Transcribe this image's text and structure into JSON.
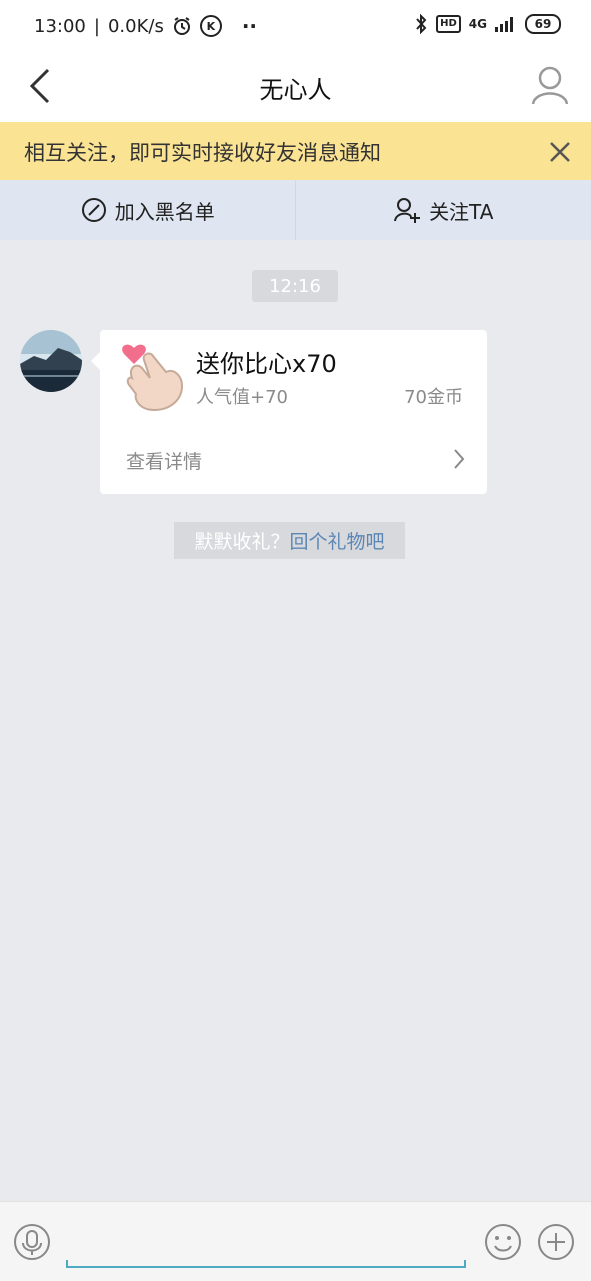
{
  "status_bar": {
    "time": "13:00",
    "speed": "0.0K/s",
    "network": "4G",
    "hd": "HD",
    "battery": "69",
    "dots": "··",
    "k_badge": "K"
  },
  "header": {
    "title": "无心人",
    "icons": {
      "back": "chevron-left-icon",
      "profile": "user-icon"
    }
  },
  "notice": {
    "text": "相互关注，即可实时接收好友消息通知"
  },
  "actions": {
    "blacklist": "加入黑名单",
    "follow": "关注TA"
  },
  "chat": {
    "timestamp": "12:16",
    "gift": {
      "title": "送你比心x70",
      "popularity": "人气值+70",
      "coins": "70金币",
      "detail": "查看详情"
    },
    "reply_prompt": {
      "muted": "默默收礼？",
      "link": "回个礼物吧"
    }
  },
  "colors": {
    "notice_bg": "#fbe394",
    "actions_bg": "#e0e5f2",
    "page_bg": "#e9eaee",
    "link": "#5b86b5",
    "input_accent": "#4fa9c0"
  }
}
